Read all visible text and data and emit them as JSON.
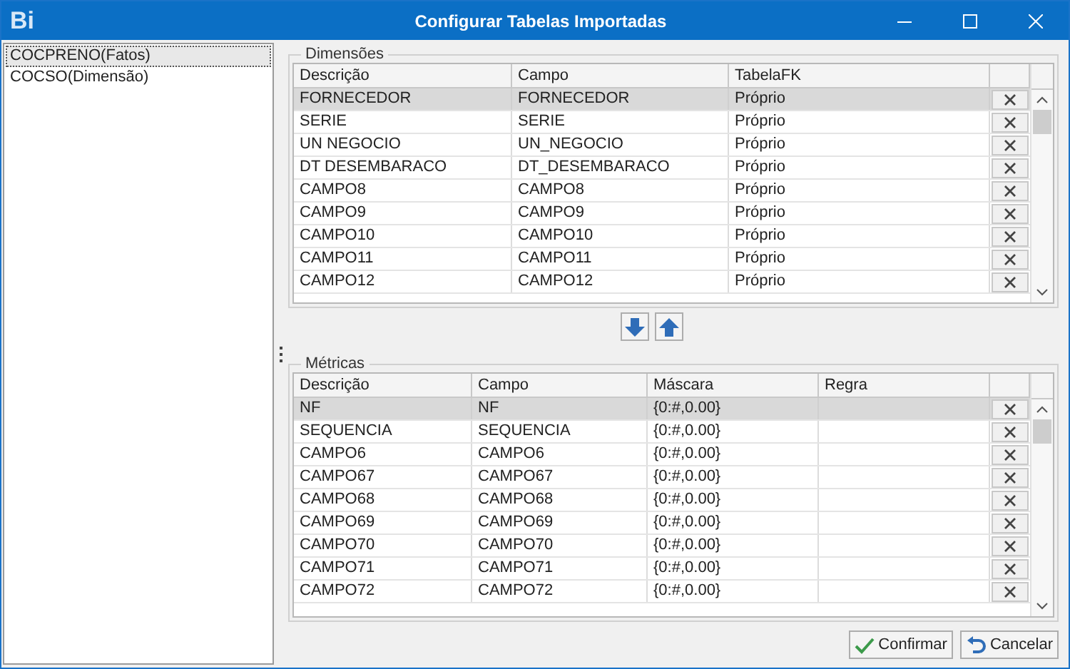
{
  "window": {
    "logo": "Bi",
    "title": "Configurar Tabelas Importadas"
  },
  "tables": [
    {
      "label": "COCPRENO(Fatos)",
      "selected": true
    },
    {
      "label": "COCSO(Dimensão)",
      "selected": false
    }
  ],
  "dimensions": {
    "title": "Dimensões",
    "columns": [
      "Descrição",
      "Campo",
      "TabelaFK"
    ],
    "rows": [
      {
        "cells": [
          "FORNECEDOR",
          "FORNECEDOR",
          "Próprio"
        ],
        "selected": true
      },
      {
        "cells": [
          "SERIE",
          "SERIE",
          "Próprio"
        ],
        "selected": false
      },
      {
        "cells": [
          "UN NEGOCIO",
          "UN_NEGOCIO",
          "Próprio"
        ],
        "selected": false
      },
      {
        "cells": [
          "DT DESEMBARACO",
          "DT_DESEMBARACO",
          "Próprio"
        ],
        "selected": false
      },
      {
        "cells": [
          "CAMPO8",
          "CAMPO8",
          "Próprio"
        ],
        "selected": false
      },
      {
        "cells": [
          "CAMPO9",
          "CAMPO9",
          "Próprio"
        ],
        "selected": false
      },
      {
        "cells": [
          "CAMPO10",
          "CAMPO10",
          "Próprio"
        ],
        "selected": false
      },
      {
        "cells": [
          "CAMPO11",
          "CAMPO11",
          "Próprio"
        ],
        "selected": false
      },
      {
        "cells": [
          "CAMPO12",
          "CAMPO12",
          "Próprio"
        ],
        "selected": false
      }
    ]
  },
  "metrics": {
    "title": "Métricas",
    "columns": [
      "Descrição",
      "Campo",
      "Máscara",
      "Regra"
    ],
    "rows": [
      {
        "cells": [
          "NF",
          "NF",
          "{0:#,0.00}"
        ],
        "selected": true
      },
      {
        "cells": [
          "SEQUENCIA",
          "SEQUENCIA",
          "{0:#,0.00}"
        ],
        "selected": false
      },
      {
        "cells": [
          "CAMPO6",
          "CAMPO6",
          "{0:#,0.00}"
        ],
        "selected": false
      },
      {
        "cells": [
          "CAMPO67",
          "CAMPO67",
          "{0:#,0.00}"
        ],
        "selected": false
      },
      {
        "cells": [
          "CAMPO68",
          "CAMPO68",
          "{0:#,0.00}"
        ],
        "selected": false
      },
      {
        "cells": [
          "CAMPO69",
          "CAMPO69",
          "{0:#,0.00}"
        ],
        "selected": false
      },
      {
        "cells": [
          "CAMPO70",
          "CAMPO70",
          "{0:#,0.00}"
        ],
        "selected": false
      },
      {
        "cells": [
          "CAMPO71",
          "CAMPO71",
          "{0:#,0.00}"
        ],
        "selected": false
      },
      {
        "cells": [
          "CAMPO72",
          "CAMPO72",
          "{0:#,0.00}"
        ],
        "selected": false
      }
    ]
  },
  "buttons": [
    {
      "label": "Confirmar",
      "kind": "confirm"
    },
    {
      "label": "Cancelar",
      "kind": "cancel"
    }
  ]
}
